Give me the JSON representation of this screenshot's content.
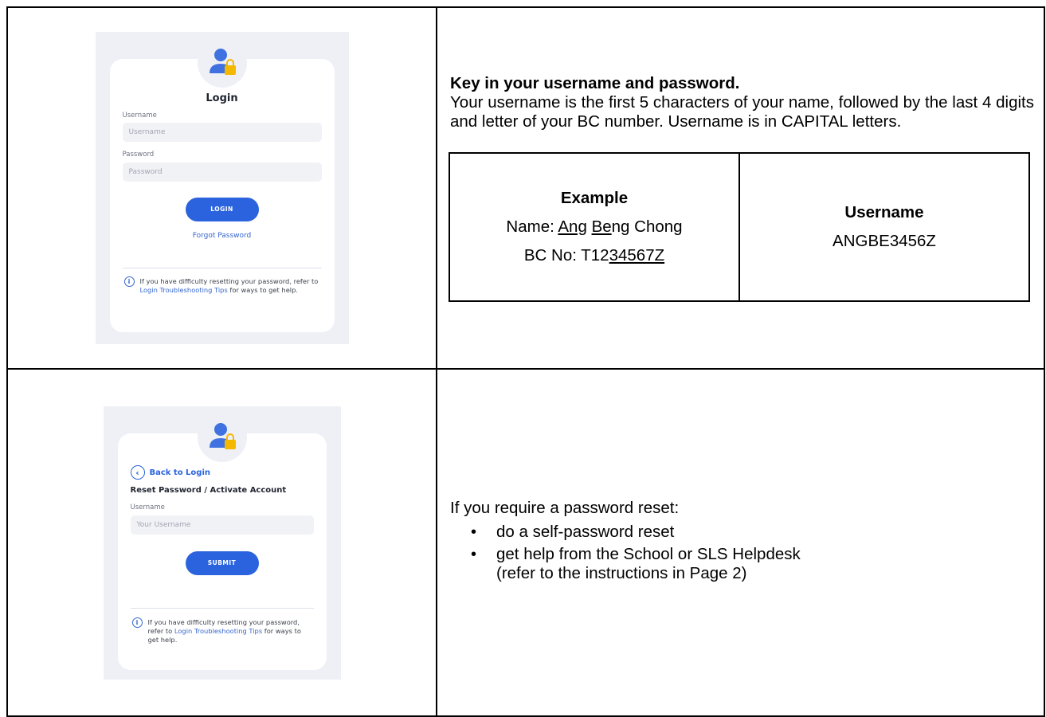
{
  "login_screen": {
    "title": "Login",
    "username_label": "Username",
    "username_placeholder": "Username",
    "password_label": "Password",
    "password_placeholder": "Password",
    "login_button": "LOGIN",
    "forgot_link": "Forgot Password",
    "info_pre": "If you have difficulty resetting your password, refer to ",
    "info_link": "Login Troubleshooting Tips",
    "info_post": " for ways to get help.",
    "icons": [
      "user-lock-icon",
      "info-icon"
    ]
  },
  "login_instructions": {
    "heading": "Key in your username and password.",
    "body": "Your username is the first 5 characters of your name, followed by the last 4 digits and letter of your BC number. Username is in CAPITAL letters.",
    "example": {
      "header": "Example",
      "name_prefix": "Name: ",
      "name_part1": "Ang",
      "name_space": " ",
      "name_part2": "Be",
      "name_rest": "ng Chong",
      "bc_prefix": "BC No: T12",
      "bc_underlined": "34567Z",
      "username_header": "Username",
      "username_value": "ANGBE3456Z"
    }
  },
  "reset_screen": {
    "back_label": "Back to Login",
    "title": "Reset Password / Activate Account",
    "username_label": "Username",
    "username_placeholder": "Your Username",
    "submit_button": "SUBMIT",
    "info_pre": "If you have difficulty resetting your password, refer to ",
    "info_link": "Login Troubleshooting Tips",
    "info_post": " for ways to get help.",
    "icons": [
      "user-lock-icon",
      "chevron-left-icon",
      "info-icon"
    ]
  },
  "reset_instructions": {
    "intro": "If you require a password reset:",
    "bullets": [
      {
        "text": "do a self-password reset",
        "sub": ""
      },
      {
        "text": "get help from the School or SLS Helpdesk",
        "sub": "(refer to the instructions in Page 2)"
      }
    ]
  }
}
